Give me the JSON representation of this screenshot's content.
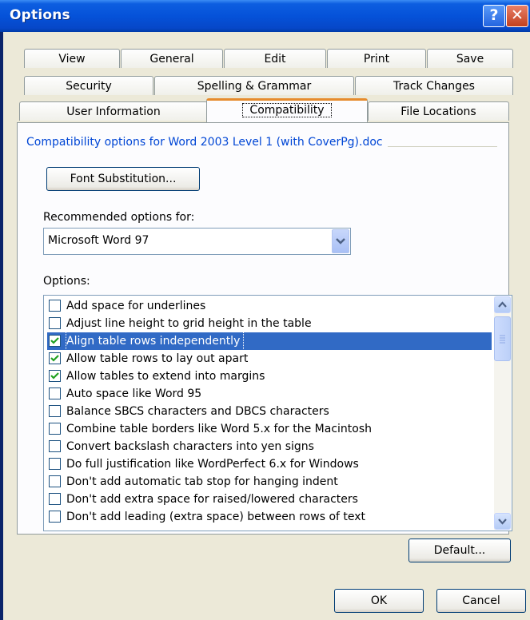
{
  "window": {
    "title": "Options",
    "help_label": "?",
    "close_label": "✕"
  },
  "tabs": {
    "row1": [
      "View",
      "General",
      "Edit",
      "Print",
      "Save"
    ],
    "row2": [
      "Security",
      "Spelling & Grammar",
      "Track Changes"
    ],
    "row3": [
      "User Information",
      "Compatibility",
      "File Locations"
    ],
    "active": "Compatibility"
  },
  "compat": {
    "group_label": "Compatibility options for Word 2003 Level 1 (with CoverPg).doc",
    "font_sub_label": "Font Substitution...",
    "recommended_label": "Recommended options for:",
    "recommended_value": "Microsoft Word 97",
    "options_label": "Options:",
    "options": [
      {
        "label": "Add space for underlines",
        "checked": false
      },
      {
        "label": "Adjust line height to grid height in the table",
        "checked": false
      },
      {
        "label": "Align table rows independently",
        "checked": true,
        "selected": true
      },
      {
        "label": "Allow table rows to lay out apart",
        "checked": true
      },
      {
        "label": "Allow tables to extend into margins",
        "checked": true
      },
      {
        "label": "Auto space like Word 95",
        "checked": false
      },
      {
        "label": "Balance SBCS characters and DBCS characters",
        "checked": false
      },
      {
        "label": "Combine table borders like Word 5.x for the Macintosh",
        "checked": false
      },
      {
        "label": "Convert backslash characters into yen signs",
        "checked": false
      },
      {
        "label": "Do full justification like WordPerfect 6.x for Windows",
        "checked": false
      },
      {
        "label": "Don't add automatic tab stop for hanging indent",
        "checked": false
      },
      {
        "label": "Don't add extra space for raised/lowered characters",
        "checked": false
      },
      {
        "label": "Don't add leading (extra space) between rows of text",
        "checked": false
      }
    ],
    "default_label": "Default..."
  },
  "footer": {
    "ok_label": "OK",
    "cancel_label": "Cancel"
  },
  "colors": {
    "titlebar": "#0552d9",
    "dialog_bg": "#ece9d8",
    "selection": "#316ac5",
    "group_text": "#0046d5",
    "active_tab_accent": "#e68b2c"
  }
}
